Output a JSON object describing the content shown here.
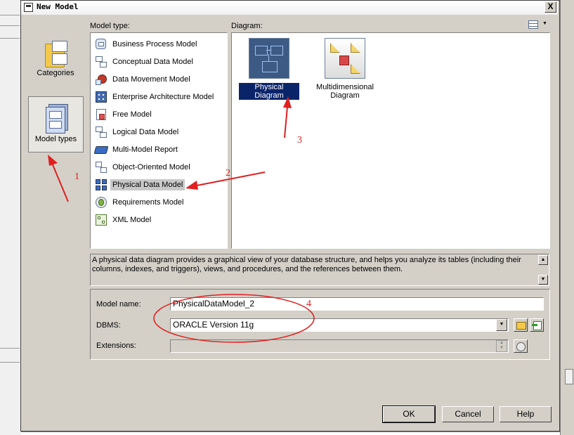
{
  "window": {
    "title": "New Model",
    "close_glyph": "X"
  },
  "categories": {
    "items": [
      {
        "label": "Categories",
        "icon": "categories-folder-icon"
      },
      {
        "label": "Model types",
        "icon": "model-types-icon",
        "selected": true
      }
    ]
  },
  "model_type": {
    "label": "Model type:",
    "items": [
      {
        "label": "Business Process Model",
        "icon": "business-process-model-icon"
      },
      {
        "label": "Conceptual Data Model",
        "icon": "conceptual-data-model-icon"
      },
      {
        "label": "Data Movement Model",
        "icon": "data-movement-model-icon"
      },
      {
        "label": "Enterprise Architecture Model",
        "icon": "enterprise-architecture-model-icon"
      },
      {
        "label": "Free Model",
        "icon": "free-model-icon"
      },
      {
        "label": "Logical Data Model",
        "icon": "logical-data-model-icon"
      },
      {
        "label": "Multi-Model Report",
        "icon": "multi-model-report-icon"
      },
      {
        "label": "Object-Oriented Model",
        "icon": "object-oriented-model-icon"
      },
      {
        "label": "Physical Data Model",
        "icon": "physical-data-model-icon",
        "selected": true
      },
      {
        "label": "Requirements Model",
        "icon": "requirements-model-icon"
      },
      {
        "label": "XML Model",
        "icon": "xml-model-icon"
      }
    ]
  },
  "diagram": {
    "label": "Diagram:",
    "view_icon": "list-view-icon",
    "items": [
      {
        "label": "Physical Diagram",
        "icon": "physical-diagram-icon",
        "selected": true
      },
      {
        "label": "Multidimensional Diagram",
        "icon": "multidimensional-diagram-icon"
      }
    ]
  },
  "description": "A physical data diagram provides a graphical view of your database structure, and helps you analyze its tables (including their columns, indexes, and triggers), views, and procedures, and the references between them.",
  "form": {
    "model_name": {
      "label": "Model name:",
      "value": "PhysicalDataModel_2"
    },
    "dbms": {
      "label": "DBMS:",
      "value": "ORACLE Version 11g"
    },
    "extensions": {
      "label": "Extensions:",
      "value": ""
    }
  },
  "buttons": {
    "ok": "OK",
    "cancel": "Cancel",
    "help": "Help"
  },
  "annotations": [
    "1",
    "2",
    "3",
    "4"
  ],
  "colors": {
    "annotation": "#e02020",
    "selection": "#0a246a",
    "dialog_bg": "#d4d0c8"
  }
}
